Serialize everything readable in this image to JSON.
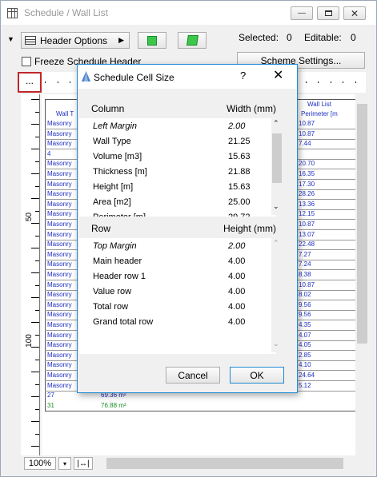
{
  "window": {
    "title": "Schedule / Wall List"
  },
  "toolbar": {
    "header_options": "Header Options",
    "selected_label": "Selected:",
    "selected_value": "0",
    "editable_label": "Editable:",
    "editable_value": "0"
  },
  "freeze": {
    "label": "Freeze Schedule Header"
  },
  "scheme": {
    "label": "Scheme Settings..."
  },
  "corner": {
    "label": "..."
  },
  "ruler": {
    "label_50": "50",
    "label_100": "100"
  },
  "sheet": {
    "header_left": "Wall T",
    "header_right": "Wall List",
    "header_right_sub": "Perimeter [m",
    "left_column": [
      "Masonry",
      "Masonry",
      "Masonry",
      "4",
      "Masonry",
      "Masonry",
      "Masonry",
      "Masonry",
      "Masonry",
      "Masonry",
      "Masonry",
      "Masonry",
      "Masonry",
      "Masonry",
      "Masonry",
      "Masonry",
      "Masonry",
      "Masonry",
      "Masonry",
      "Masonry",
      "Masonry",
      "Masonry",
      "Masonry",
      "Masonry",
      "Masonry",
      "Masonry",
      "Masonry"
    ],
    "right_column": [
      "10.87",
      "10.87",
      "7.44",
      "",
      "20.70",
      "16.35",
      "17.30",
      "28.26",
      "13.36",
      "12.15",
      "10.87",
      "13.07",
      "22.48",
      "7.27",
      "7.24",
      "8.38",
      "10.87",
      "8.02",
      "9.56",
      "9.56",
      "4.35",
      "4.07",
      "4.05",
      "2.85",
      "4.10",
      "24.64",
      "5.12"
    ],
    "total_row": {
      "count": "27",
      "area": "69.36 m²"
    },
    "grand_row": {
      "count": "31",
      "area": "76.88 m²"
    }
  },
  "status": {
    "zoom": "100%"
  },
  "dialog": {
    "title": "Schedule Cell Size",
    "help": "?",
    "column_header": "Column",
    "width_header": "Width",
    "width_unit": "(mm)",
    "columns": [
      {
        "name": "Left Margin",
        "value": "2.00",
        "italic": true
      },
      {
        "name": "Wall Type",
        "value": "21.25"
      },
      {
        "name": "Volume [m3]",
        "value": "15.63"
      },
      {
        "name": "Thickness [m]",
        "value": "21.88"
      },
      {
        "name": "Height [m]",
        "value": "15.63"
      },
      {
        "name": "Area [m2]",
        "value": "25.00"
      },
      {
        "name": "Perimeter [m]",
        "value": "29.72"
      }
    ],
    "row_header": "Row",
    "height_header": "Height",
    "height_unit": "(mm)",
    "rows": [
      {
        "name": "Top Margin",
        "value": "2.00",
        "italic": true
      },
      {
        "name": "Main header",
        "value": "4.00"
      },
      {
        "name": "Header row 1",
        "value": "4.00"
      },
      {
        "name": "Value row",
        "value": "4.00"
      },
      {
        "name": "Total row",
        "value": "4.00"
      },
      {
        "name": "Grand total row",
        "value": "4.00"
      }
    ],
    "cancel": "Cancel",
    "ok": "OK"
  }
}
